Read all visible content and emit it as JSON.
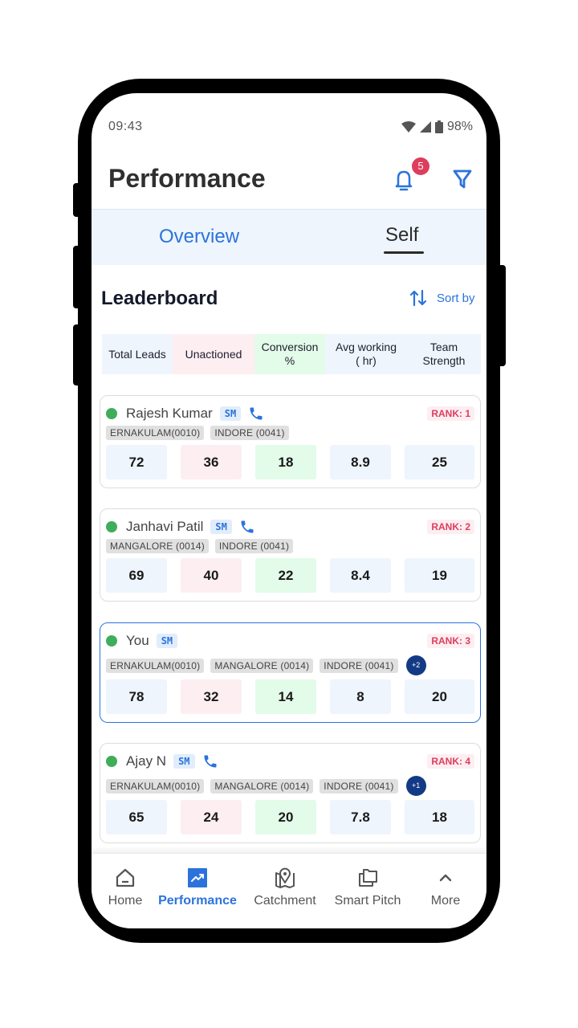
{
  "status_bar": {
    "time": "09:43",
    "battery": "98%",
    "icons": [
      "wifi-icon",
      "signal-icon",
      "battery-icon"
    ]
  },
  "header": {
    "title": "Performance",
    "notification_count": "5",
    "icons": [
      "bell-icon",
      "filter-icon"
    ]
  },
  "tabs": [
    {
      "label": "Overview",
      "active": false
    },
    {
      "label": "Self",
      "active": true
    }
  ],
  "leaderboard": {
    "title": "Leaderboard",
    "sort_label": "Sort by",
    "columns": [
      "Total Leads",
      "Unactioned",
      "Conversion %",
      "Avg working ( hr)",
      "Team Strength"
    ],
    "members": [
      {
        "name": "Rajesh Kumar",
        "role": "SM",
        "rank": "RANK: 1",
        "callable": true,
        "is_self": false,
        "locations": [
          "ERNAKULAM(0010)",
          "INDORE (0041)"
        ],
        "more_locations": null,
        "metrics": [
          "72",
          "36",
          "18",
          "8.9",
          "25"
        ]
      },
      {
        "name": "Janhavi Patil",
        "role": "SM",
        "rank": "RANK: 2",
        "callable": true,
        "is_self": false,
        "locations": [
          "MANGALORE (0014)",
          "INDORE (0041)"
        ],
        "more_locations": null,
        "metrics": [
          "69",
          "40",
          "22",
          "8.4",
          "19"
        ]
      },
      {
        "name": "You",
        "role": "SM",
        "rank": "RANK: 3",
        "callable": false,
        "is_self": true,
        "locations": [
          "ERNAKULAM(0010)",
          "MANGALORE (0014)",
          "INDORE (0041)"
        ],
        "more_locations": "+2",
        "metrics": [
          "78",
          "32",
          "14",
          "8",
          "20"
        ]
      },
      {
        "name": "Ajay N",
        "role": "SM",
        "rank": "RANK: 4",
        "callable": true,
        "is_self": false,
        "locations": [
          "ERNAKULAM(0010)",
          "MANGALORE (0014)",
          "INDORE (0041)"
        ],
        "more_locations": "+1",
        "metrics": [
          "65",
          "24",
          "20",
          "7.8",
          "18"
        ]
      }
    ]
  },
  "bottom_nav": [
    {
      "label": "Home",
      "icon": "home-icon",
      "active": false
    },
    {
      "label": "Performance",
      "icon": "trending-up-icon",
      "active": true
    },
    {
      "label": "Catchment",
      "icon": "map-pin-icon",
      "active": false
    },
    {
      "label": "Smart Pitch",
      "icon": "folders-icon",
      "active": false
    },
    {
      "label": "More",
      "icon": "chevron-up-icon",
      "active": false
    }
  ],
  "colors": {
    "accent": "#2b73dc",
    "rank_red": "#dc3e5c",
    "online_green": "#40ad5a",
    "badge_navy": "#133a85",
    "col_blue": "#eef5fd",
    "col_pink": "#fdeef2",
    "col_green": "#e3fbe9"
  }
}
